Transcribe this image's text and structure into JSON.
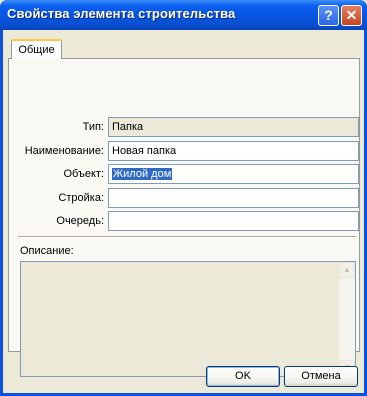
{
  "window": {
    "title": "Свойства элемента строительства"
  },
  "titlebar_buttons": {
    "help": "?",
    "close": "✕"
  },
  "tabs": [
    {
      "label": "Общие"
    }
  ],
  "form": {
    "type": {
      "label": "Тип:",
      "value": "Папка"
    },
    "name": {
      "label": "Наименование:",
      "value": "Новая папка"
    },
    "object": {
      "label": "Объект:",
      "value": "Жилой дом"
    },
    "construction": {
      "label": "Стройка:",
      "value": ""
    },
    "queue": {
      "label": "Очередь:",
      "value": ""
    }
  },
  "description": {
    "label": "Описание:",
    "value": ""
  },
  "scrollbar": {
    "up_icon": "▲",
    "down_icon": "▼"
  },
  "buttons": {
    "ok": "OK",
    "cancel": "Отмена"
  }
}
